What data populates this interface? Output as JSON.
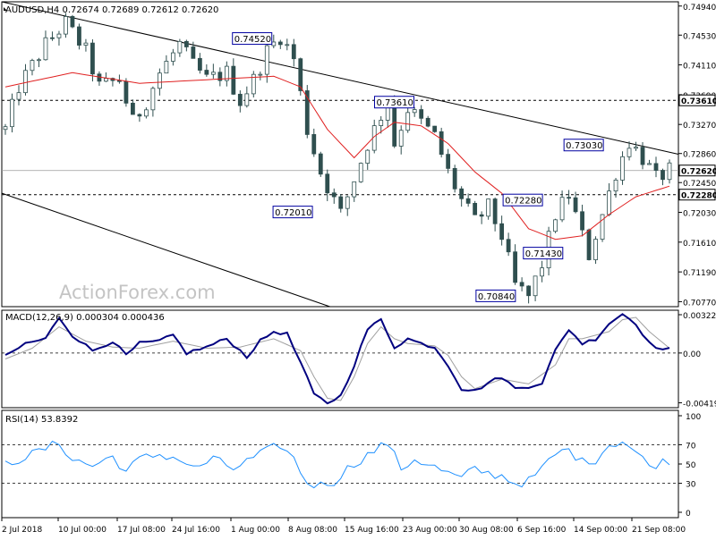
{
  "chart_data": {
    "type": "candlestick",
    "header": {
      "symbol": "AUDUSD,H4",
      "ohlc": [
        "0.72674",
        "0.72689",
        "0.72612",
        "0.72620"
      ]
    },
    "watermark": "ActionForex.com",
    "x_tick_labels": [
      "2 Jul 2018",
      "10 Jul 00:00",
      "17 Jul 08:00",
      "24 Jul 16:00",
      "1 Aug 00:00",
      "8 Aug 08:00",
      "15 Aug 16:00",
      "23 Aug 00:00",
      "30 Aug 08:00",
      "6 Sep 16:00",
      "14 Sep 00:00",
      "21 Sep 08:00"
    ],
    "price_panel": {
      "y_range": [
        0.707,
        0.75
      ],
      "y_ticks": [
        "0.74940",
        "0.74530",
        "0.74110",
        "0.73690",
        "0.73270",
        "0.72860",
        "0.72450",
        "0.72030",
        "0.71610",
        "0.71190",
        "0.70770"
      ],
      "annotations": [
        {
          "label": "0.74520",
          "value": 0.7452
        },
        {
          "label": "0.73610",
          "value": 0.7361
        },
        {
          "label": "0.72010",
          "value": 0.7201
        },
        {
          "label": "0.73030",
          "value": 0.7303
        },
        {
          "label": "0.72280",
          "value": 0.7228
        },
        {
          "label": "0.71430",
          "value": 0.7143
        },
        {
          "label": "0.70840",
          "value": 0.7084
        }
      ],
      "price_tags": [
        {
          "label": "0.73610",
          "value": 0.7361
        },
        {
          "label": "0.72620",
          "value": 0.7262
        },
        {
          "label": "0.72280",
          "value": 0.7228
        }
      ],
      "horizontal_levels": [
        0.7361,
        0.7262,
        0.7228
      ],
      "upper_trendline": [
        [
          0.0,
          0.75
        ],
        [
          1.0,
          0.7285
        ]
      ],
      "lower_trendline": [
        [
          0.0,
          0.723
        ],
        [
          0.485,
          0.707
        ]
      ],
      "price_anchors": [
        [
          0,
          0.732
        ],
        [
          2,
          0.738
        ],
        [
          6,
          0.744
        ],
        [
          9,
          0.747
        ],
        [
          12,
          0.743
        ],
        [
          14,
          0.738
        ],
        [
          17,
          0.739
        ],
        [
          19,
          0.733
        ],
        [
          21,
          0.736
        ],
        [
          23,
          0.74
        ],
        [
          26,
          0.744
        ],
        [
          28,
          0.741
        ],
        [
          30,
          0.739
        ],
        [
          33,
          0.74
        ],
        [
          35,
          0.736
        ],
        [
          37,
          0.739
        ],
        [
          39,
          0.743
        ],
        [
          41,
          0.7452
        ],
        [
          43,
          0.742
        ],
        [
          45,
          0.732
        ],
        [
          47,
          0.726
        ],
        [
          49,
          0.722
        ],
        [
          50,
          0.7201
        ],
        [
          52,
          0.725
        ],
        [
          54,
          0.73
        ],
        [
          56,
          0.734
        ],
        [
          57,
          0.7361
        ],
        [
          58,
          0.73
        ],
        [
          60,
          0.735
        ],
        [
          62,
          0.733
        ],
        [
          64,
          0.731
        ],
        [
          66,
          0.726
        ],
        [
          68,
          0.722
        ],
        [
          70,
          0.719
        ],
        [
          72,
          0.721
        ],
        [
          74,
          0.717
        ],
        [
          76,
          0.71
        ],
        [
          78,
          0.7084
        ],
        [
          80,
          0.713
        ],
        [
          82,
          0.72
        ],
        [
          84,
          0.7228
        ],
        [
          86,
          0.717
        ],
        [
          87,
          0.7143
        ],
        [
          89,
          0.72
        ],
        [
          91,
          0.726
        ],
        [
          93,
          0.7303
        ],
        [
          95,
          0.728
        ],
        [
          97,
          0.725
        ],
        [
          99,
          0.7262
        ]
      ],
      "ma_anchors": [
        [
          0,
          0.738
        ],
        [
          10,
          0.74
        ],
        [
          20,
          0.7385
        ],
        [
          30,
          0.739
        ],
        [
          40,
          0.7395
        ],
        [
          44,
          0.738
        ],
        [
          48,
          0.732
        ],
        [
          52,
          0.728
        ],
        [
          55,
          0.731
        ],
        [
          58,
          0.733
        ],
        [
          62,
          0.7325
        ],
        [
          66,
          0.73
        ],
        [
          70,
          0.726
        ],
        [
          74,
          0.723
        ],
        [
          78,
          0.718
        ],
        [
          82,
          0.7165
        ],
        [
          86,
          0.717
        ],
        [
          90,
          0.72
        ],
        [
          94,
          0.7225
        ],
        [
          99,
          0.724
        ]
      ]
    },
    "macd_panel": {
      "label": "MACD(12,26,9) 0.000304 0.000436",
      "y_range": [
        -0.0046,
        0.0036
      ],
      "y_ticks": [
        "0.003223",
        "0.00",
        "-0.004191"
      ],
      "macd_anchors": [
        [
          0,
          -0.0003
        ],
        [
          3,
          0.0008
        ],
        [
          6,
          0.0012
        ],
        [
          8,
          0.003
        ],
        [
          10,
          0.0015
        ],
        [
          13,
          0.0002
        ],
        [
          16,
          0.001
        ],
        [
          18,
          -0.0002
        ],
        [
          20,
          0.0008
        ],
        [
          23,
          0.001
        ],
        [
          25,
          0.0015
        ],
        [
          27,
          0.0
        ],
        [
          30,
          0.0005
        ],
        [
          33,
          0.0012
        ],
        [
          36,
          -0.0003
        ],
        [
          38,
          0.001
        ],
        [
          40,
          0.0018
        ],
        [
          42,
          0.0016
        ],
        [
          44,
          -0.0008
        ],
        [
          46,
          -0.0035
        ],
        [
          48,
          -0.0042
        ],
        [
          50,
          -0.0036
        ],
        [
          52,
          -0.001
        ],
        [
          54,
          0.002
        ],
        [
          56,
          0.0028
        ],
        [
          58,
          0.0005
        ],
        [
          60,
          0.0012
        ],
        [
          62,
          0.0008
        ],
        [
          64,
          0.0005
        ],
        [
          66,
          -0.001
        ],
        [
          68,
          -0.003
        ],
        [
          70,
          -0.0032
        ],
        [
          72,
          -0.0025
        ],
        [
          74,
          -0.002
        ],
        [
          76,
          -0.003
        ],
        [
          78,
          -0.0028
        ],
        [
          80,
          -0.0025
        ],
        [
          82,
          0.0002
        ],
        [
          84,
          0.002
        ],
        [
          86,
          0.0008
        ],
        [
          88,
          0.0012
        ],
        [
          90,
          0.0025
        ],
        [
          92,
          0.0033
        ],
        [
          94,
          0.0025
        ],
        [
          96,
          0.0008
        ],
        [
          98,
          0.0003
        ],
        [
          99,
          0.0003
        ]
      ],
      "signal_anchors": [
        [
          0,
          -0.0005
        ],
        [
          4,
          0.0004
        ],
        [
          8,
          0.0022
        ],
        [
          12,
          0.001
        ],
        [
          16,
          0.0005
        ],
        [
          20,
          0.0004
        ],
        [
          25,
          0.001
        ],
        [
          30,
          0.0004
        ],
        [
          35,
          0.0005
        ],
        [
          40,
          0.0012
        ],
        [
          44,
          0.0002
        ],
        [
          46,
          -0.002
        ],
        [
          48,
          -0.0038
        ],
        [
          50,
          -0.004
        ],
        [
          52,
          -0.002
        ],
        [
          54,
          0.0008
        ],
        [
          56,
          0.0022
        ],
        [
          58,
          0.0012
        ],
        [
          60,
          0.0008
        ],
        [
          64,
          0.0006
        ],
        [
          66,
          -0.0002
        ],
        [
          68,
          -0.002
        ],
        [
          70,
          -0.003
        ],
        [
          74,
          -0.0022
        ],
        [
          78,
          -0.0026
        ],
        [
          82,
          -0.001
        ],
        [
          84,
          0.0012
        ],
        [
          86,
          0.0012
        ],
        [
          90,
          0.0018
        ],
        [
          92,
          0.0028
        ],
        [
          94,
          0.003
        ],
        [
          96,
          0.0018
        ],
        [
          99,
          0.0004
        ]
      ]
    },
    "rsi_panel": {
      "label": "RSI(14) 53.8392",
      "y_range": [
        0,
        100
      ],
      "y_ticks": [
        "100",
        "70",
        "50",
        "30",
        "0"
      ],
      "rsi_anchors": [
        [
          0,
          50
        ],
        [
          4,
          60
        ],
        [
          8,
          72
        ],
        [
          10,
          55
        ],
        [
          13,
          48
        ],
        [
          16,
          58
        ],
        [
          18,
          42
        ],
        [
          20,
          55
        ],
        [
          23,
          60
        ],
        [
          26,
          55
        ],
        [
          28,
          45
        ],
        [
          31,
          55
        ],
        [
          34,
          45
        ],
        [
          38,
          60
        ],
        [
          41,
          70
        ],
        [
          43,
          55
        ],
        [
          45,
          30
        ],
        [
          47,
          28
        ],
        [
          49,
          32
        ],
        [
          51,
          45
        ],
        [
          53,
          55
        ],
        [
          56,
          68
        ],
        [
          57,
          72
        ],
        [
          59,
          45
        ],
        [
          61,
          55
        ],
        [
          63,
          50
        ],
        [
          66,
          40
        ],
        [
          68,
          35
        ],
        [
          70,
          45
        ],
        [
          72,
          40
        ],
        [
          74,
          38
        ],
        [
          76,
          30
        ],
        [
          78,
          32
        ],
        [
          80,
          45
        ],
        [
          82,
          60
        ],
        [
          84,
          65
        ],
        [
          86,
          52
        ],
        [
          88,
          55
        ],
        [
          90,
          70
        ],
        [
          92,
          74
        ],
        [
          94,
          62
        ],
        [
          96,
          48
        ],
        [
          99,
          54
        ]
      ]
    }
  }
}
